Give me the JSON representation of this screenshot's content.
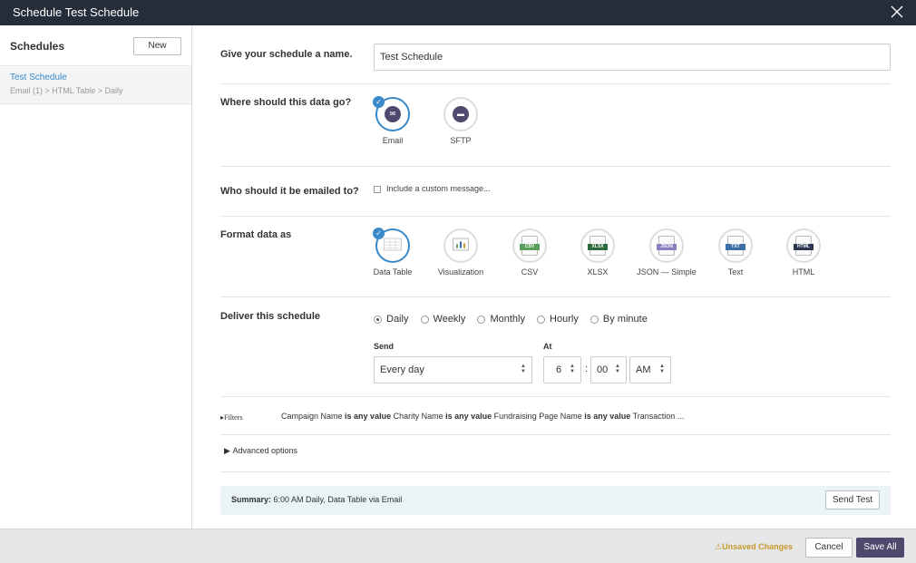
{
  "window": {
    "title": "Schedule Test Schedule"
  },
  "sidebar": {
    "header": "Schedules",
    "new_label": "New",
    "items": [
      {
        "name": "Test Schedule",
        "path": "Email (1) > HTML Table > Daily"
      }
    ]
  },
  "form": {
    "name_label": "Give your schedule a name.",
    "name_value": "Test Schedule",
    "destination_label": "Where should this data go?",
    "destinations": [
      {
        "label": "Email",
        "icon": "envelope-icon",
        "selected": true
      },
      {
        "label": "SFTP",
        "icon": "folder-icon",
        "selected": false
      }
    ],
    "recipients_label": "Who should it be emailed to?",
    "custom_message_label": "Include a custom message...",
    "format_label": "Format data as",
    "formats": [
      {
        "label": "Data Table",
        "icon": "table-icon",
        "selected": true
      },
      {
        "label": "Visualization",
        "icon": "chart-icon",
        "selected": false
      },
      {
        "label": "CSV",
        "tag": "CSV",
        "tag_color": "#5a9e5a",
        "selected": false
      },
      {
        "label": "XLSX",
        "tag": "XLSX",
        "tag_color": "#2e6b3c",
        "selected": false
      },
      {
        "label": "JSON — Simple",
        "tag": "JSON",
        "tag_color": "#8a7fc0",
        "selected": false
      },
      {
        "label": "Text",
        "tag": "TXT",
        "tag_color": "#3a6ea5",
        "selected": false
      },
      {
        "label": "HTML",
        "tag": "HTML",
        "tag_color": "#2b3550",
        "selected": false
      }
    ],
    "deliver_label": "Deliver this schedule",
    "frequencies": [
      {
        "label": "Daily",
        "selected": true
      },
      {
        "label": "Weekly",
        "selected": false
      },
      {
        "label": "Monthly",
        "selected": false
      },
      {
        "label": "Hourly",
        "selected": false
      },
      {
        "label": "By minute",
        "selected": false
      }
    ],
    "send_label": "Send",
    "send_value": "Every day",
    "at_label": "At",
    "hour_value": "6",
    "time_separator": ":",
    "minute_value": "00",
    "ampm_value": "AM",
    "filters_toggle": "Filters",
    "filters": [
      {
        "field": "Campaign Name",
        "op": "is any value"
      },
      {
        "field": "Charity Name",
        "op": "is any value"
      },
      {
        "field": "Fundraising Page Name",
        "op": "is any value"
      }
    ],
    "filters_tail": "Transaction ...",
    "advanced_label": "Advanced options",
    "summary_label": "Summary:",
    "summary_value": "6:00 AM Daily, Data Table via Email",
    "send_test_label": "Send Test"
  },
  "footer": {
    "unsaved_label": "Unsaved Changes",
    "cancel_label": "Cancel",
    "save_label": "Save All"
  },
  "colors": {
    "accent": "#3a89c9",
    "brand": "#4e4a6e",
    "titlebar": "#262d3a",
    "warning": "#c79a2a"
  }
}
